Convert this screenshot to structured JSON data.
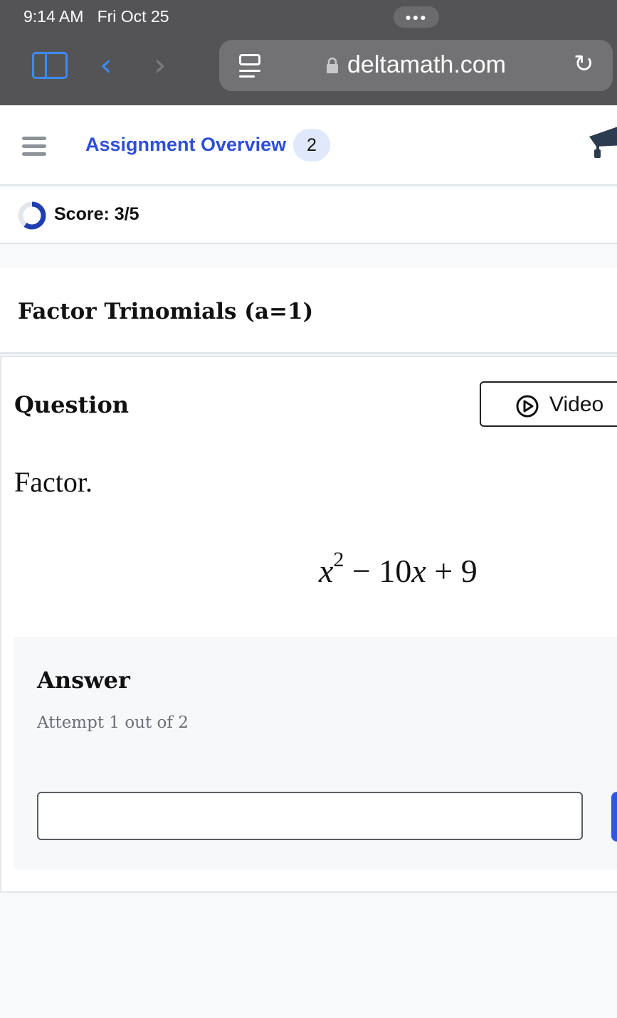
{
  "status_bar": {
    "time": "9:14 AM",
    "date": "Fri Oct 25"
  },
  "browser": {
    "url": "deltamath.com",
    "accent": "#3d8af7"
  },
  "nav": {
    "overview_label": "Assignment Overview",
    "badge_count": "2",
    "link_color": "#2f4fd8"
  },
  "score": {
    "label": "Score: 3/5",
    "earned": 3,
    "total": 5
  },
  "assignment": {
    "title": "Factor Trinomials (a=1)"
  },
  "question": {
    "heading": "Question",
    "video_label": "Video",
    "prompt": "Factor.",
    "expression": {
      "var1": "x",
      "exp": "2",
      "mid": " − 10",
      "var2": "x",
      "tail": " + 9"
    }
  },
  "answer": {
    "heading": "Answer",
    "attempt": "Attempt 1 out of 2",
    "input_value": ""
  }
}
